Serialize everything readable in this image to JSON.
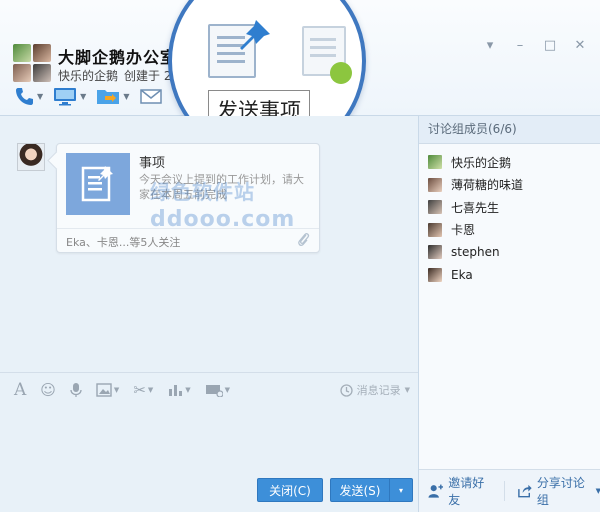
{
  "header": {
    "title": "大脚企鹅办公室",
    "creator": "快乐的企鹅",
    "created_label": "创建于 201",
    "window_controls": [
      "▾",
      "–",
      "□",
      "✕"
    ]
  },
  "magnifier": {
    "tooltip": "发送事项"
  },
  "card": {
    "title": "事项",
    "description": "今天会议上提到的工作计划，请大家在本周五前完成",
    "followers": "Eka、卡恩...等5人关注"
  },
  "watermark": {
    "brand": "绿色软件站",
    "domain": "ddooo.com"
  },
  "input_toolbar": {
    "history_label": "消息记录"
  },
  "buttons": {
    "close": "关闭(C)",
    "send": "发送(S)",
    "send_dropdown": "▾"
  },
  "members": {
    "header": "讨论组成员(6/6)",
    "list": [
      "快乐的企鹅",
      "薄荷糖的味道",
      "七喜先生",
      "卡恩",
      "stephen",
      "Eka"
    ],
    "invite_label": "邀请好友",
    "share_label": "分享讨论组"
  },
  "colors": {
    "accent": "#3d8fd9",
    "magnifier_ring": "#3f78c0",
    "pin": "#2f7ecf",
    "card_thumb": "#7da7dc"
  }
}
